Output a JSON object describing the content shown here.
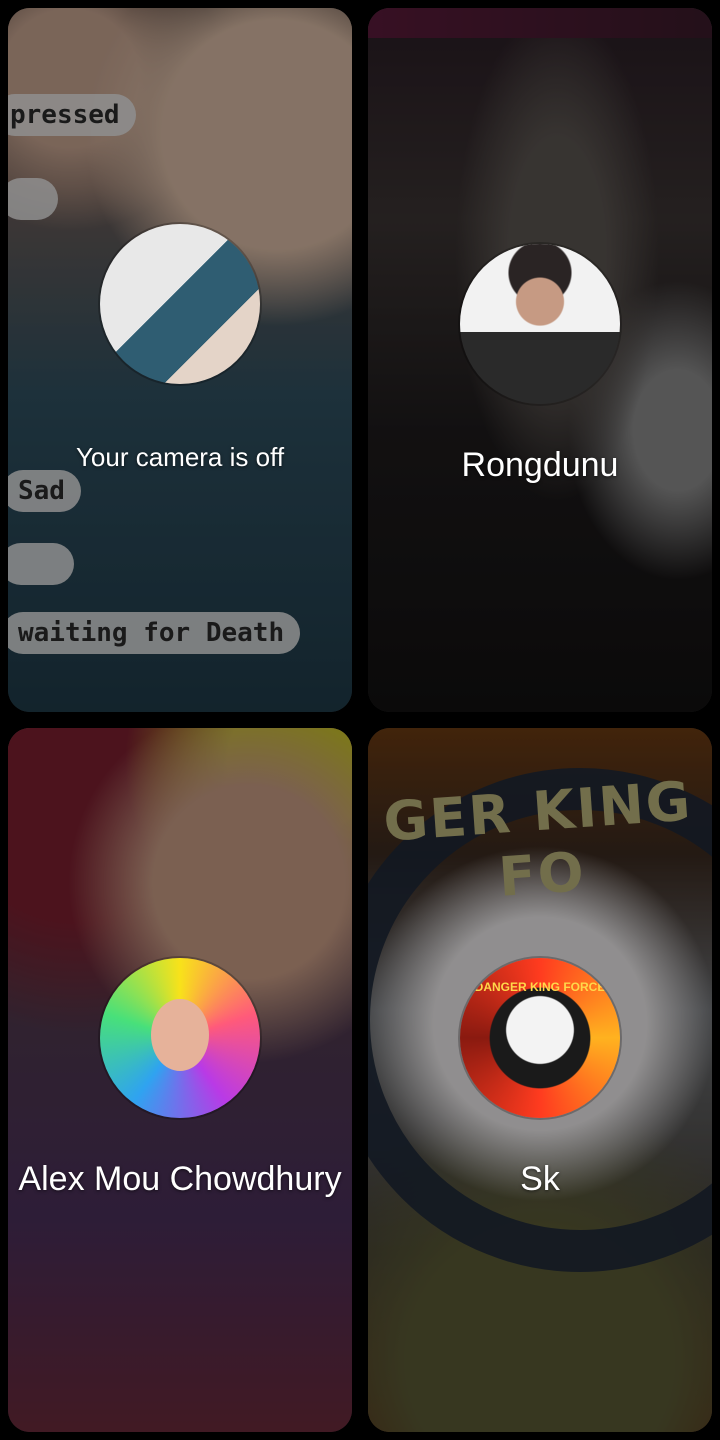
{
  "tiles": [
    {
      "id": "self",
      "name": "Your camera is off",
      "background_text": [
        "pressed",
        "Sad",
        "waiting for Death"
      ]
    },
    {
      "id": "rongdunu",
      "name": "Rongdunu"
    },
    {
      "id": "alex",
      "name": "Alex Mou Chowdhury"
    },
    {
      "id": "sk",
      "name": "Sk",
      "background_text": [
        "GER KING FO"
      ],
      "avatar_text": "DANGER KING FORCE"
    }
  ],
  "colors": {
    "background": "#000000",
    "label": "#ffffff"
  }
}
